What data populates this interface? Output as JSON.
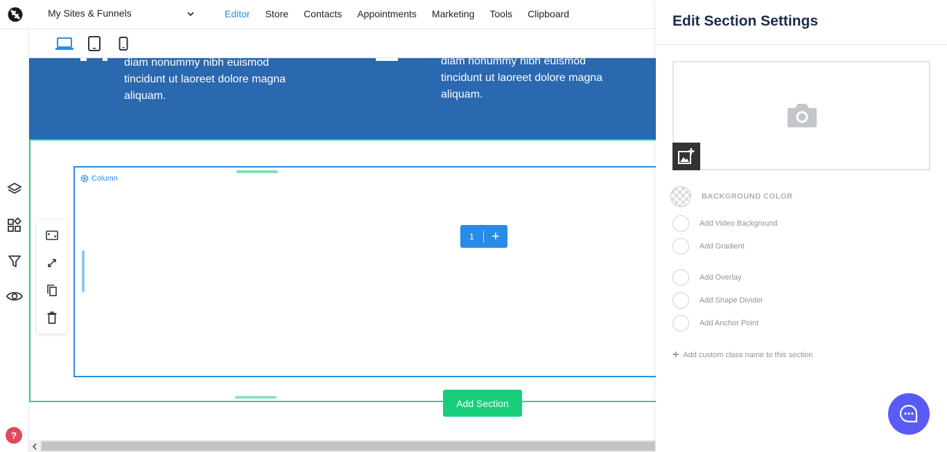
{
  "topbar": {
    "site_selector": "My Sites & Funnels",
    "nav": [
      {
        "label": "Editor",
        "active": true
      },
      {
        "label": "Store",
        "active": false
      },
      {
        "label": "Contacts",
        "active": false
      },
      {
        "label": "Appointments",
        "active": false
      },
      {
        "label": "Marketing",
        "active": false
      },
      {
        "label": "Tools",
        "active": false
      },
      {
        "label": "Clipboard",
        "active": false
      }
    ]
  },
  "device_toolbar": {
    "devices": [
      "desktop-icon",
      "tablet-icon",
      "mobile-icon"
    ],
    "active": "desktop"
  },
  "left_rail": {
    "icons": [
      "layers-icon",
      "widgets-icon",
      "funnel-icon",
      "eye-icon"
    ],
    "help_label": "?"
  },
  "canvas": {
    "band_text_left": "diam nonummy nibh euismod tincidunt ut laoreet dolore magna aliquam.",
    "band_text_right": "diam nonummy nibh euismod tincidunt ut laoreet dolore magna aliquam.",
    "band_color": "#2a68b0",
    "column_label": "Column",
    "column_count": "1",
    "add_column_symbol": "+",
    "add_section_label": "Add Section",
    "section_border_color": "#2fd08a",
    "column_border_color": "#2a8be6",
    "toolstrip_icons": [
      "aspect-ratio-icon",
      "resize-icon",
      "copy-icon",
      "trash-icon"
    ]
  },
  "panel": {
    "title": "Edit Section Settings",
    "background_color_label": "BACKGROUND COLOR",
    "options": [
      "Add Video Background",
      "Add Gradient",
      "Add Overlay",
      "Add Shape Divider",
      "Add Anchor Point"
    ],
    "custom_class_label": "Add custom class name to this section",
    "chat_color": "#5a5bf5"
  }
}
